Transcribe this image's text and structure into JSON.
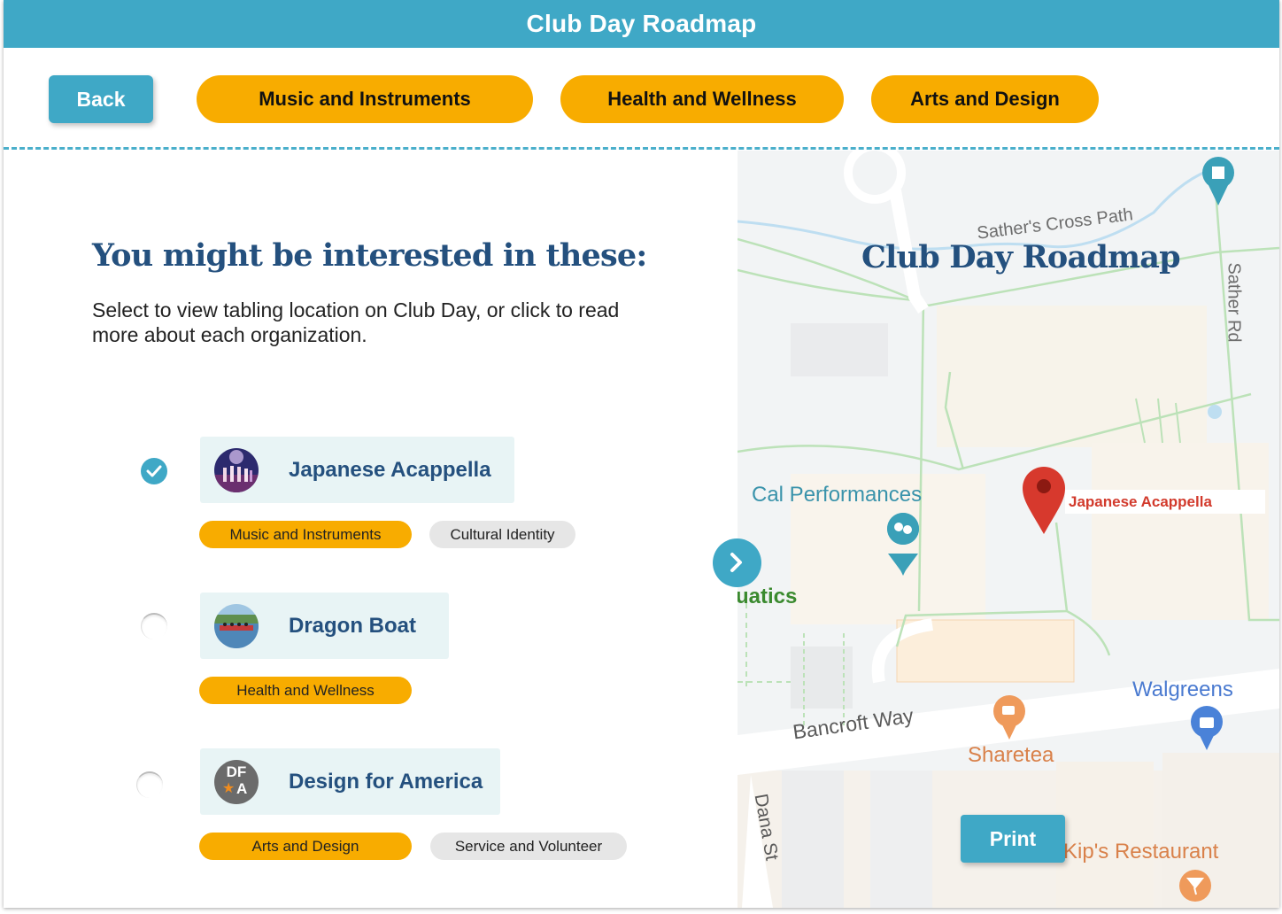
{
  "header": {
    "title": "Club Day Roadmap"
  },
  "nav": {
    "back_label": "Back",
    "categories": [
      {
        "label": "Music and Instruments"
      },
      {
        "label": "Health and Wellness"
      },
      {
        "label": "Arts and Design"
      }
    ]
  },
  "main": {
    "heading": "You might be interested in these:",
    "subtext": "Select to view tabling location on Club Day, or click to read more about each organization.",
    "organizations": [
      {
        "name": "Japanese Acappella",
        "selected": true,
        "tags": [
          "Music and Instruments",
          "Cultural Identity"
        ]
      },
      {
        "name": "Dragon Boat",
        "selected": false,
        "tags": [
          "Health and Wellness"
        ]
      },
      {
        "name": "Design for America",
        "selected": false,
        "tags": [
          "Arts and Design",
          "Service and Volunteer"
        ],
        "avatar_text": [
          "DF",
          "A"
        ]
      }
    ]
  },
  "map": {
    "title": "Club Day Roadmap",
    "pin_label": "Japanese Acappella",
    "print_label": "Print",
    "places": {
      "cal_performances": "Cal Performances",
      "aquatics": "uatics",
      "walgreens": "Walgreens",
      "sharetea": "Sharetea",
      "kips": "Kip's Restaurant"
    },
    "streets": {
      "sathers_cross_path": "Sather's Cross Path",
      "sather_rd": "Sather Rd",
      "bancroft_way": "Bancroft Way",
      "dana_st": "Dana St"
    }
  },
  "colors": {
    "primary": "#3fa8c6",
    "accent": "#f8ac00",
    "heading": "#24507e",
    "card": "#e8f4f5",
    "pin": "#d23a2c"
  }
}
